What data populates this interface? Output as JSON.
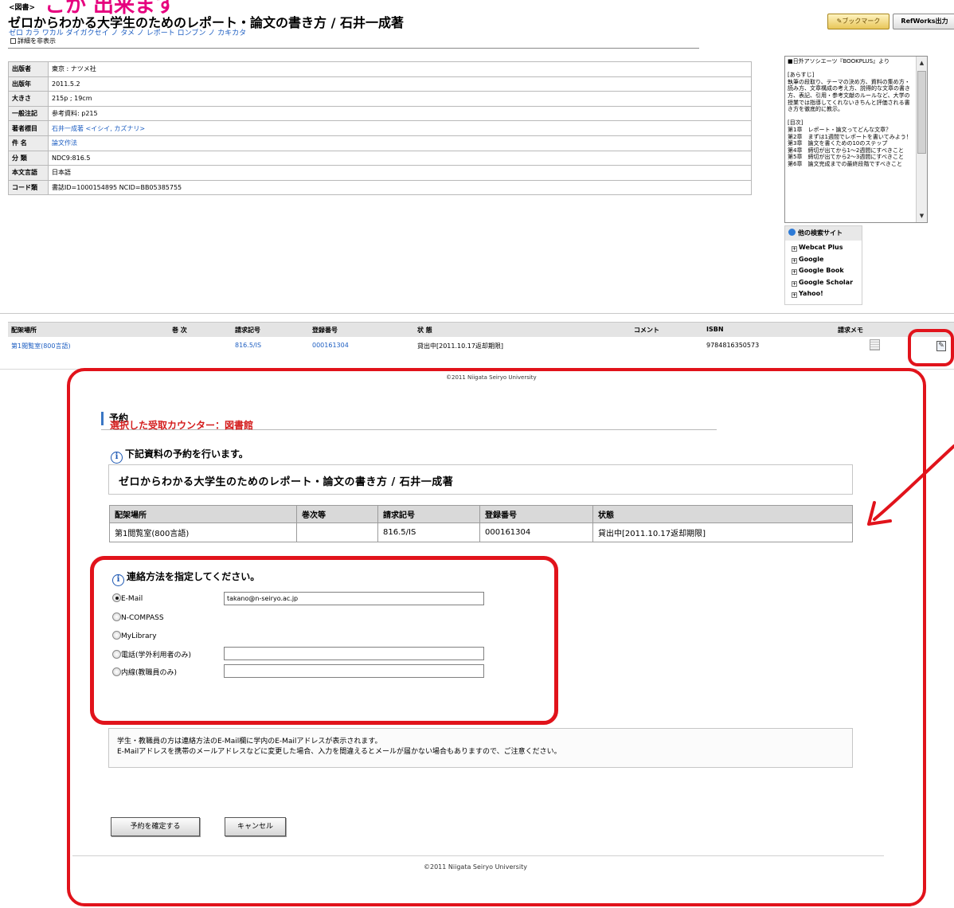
{
  "banner": {
    "text": "こか 出来ます"
  },
  "record": {
    "category": "<図書>",
    "title": "ゼロからわかる大学生のためのレポート・論文の書き方 / 石井一成著",
    "kana": "ゼロ カラ ワカル ダイガクセイ ノ タメ ノ レポート ロンブン ノ カキカタ",
    "detail_toggle": "詳細を非表示",
    "bookmark_label": "ブックマーク",
    "refworks_label": "RefWorks出力",
    "fields": [
      {
        "label": "出版者",
        "value": "東京 : ナツメ社",
        "link": false
      },
      {
        "label": "出版年",
        "value": "2011.5.2",
        "link": false
      },
      {
        "label": "大きさ",
        "value": "215p ; 19cm",
        "link": false
      },
      {
        "label": "一般注記",
        "value": "参考資料: p215",
        "link": false
      },
      {
        "label": "著者標目",
        "value": "石井一成著 <イシイ, カズナリ>",
        "link": true
      },
      {
        "label": "件 名",
        "value": "論文作法",
        "link": true
      },
      {
        "label": "分 類",
        "value": "NDC9:816.5",
        "link": false
      },
      {
        "label": "本文言語",
        "value": "日本語",
        "link": false
      },
      {
        "label": "コード類",
        "value": "書誌ID=1000154895 NCID=BB05385755",
        "link": false
      }
    ]
  },
  "synopsis": {
    "text": "■日外アソシエーツ『BOOKPLUS』より\n\n[あらすじ]\n執筆の段取り、テーマの決め方、資料の集め方・読み方、文章構成の考え方、説得的な文章の書き方、表記、引用・参考文献のルールなど、大学の授業では指導してくれないきちんと評価される書き方を徹底的に教示。\n\n[目次]\n第1章　レポート・論文ってどんな文章？\n第2章　まずは1週間でレポートを書いてみよう！\n第3章　論文を書くための10のステップ\n第4章　締切が出てから1～2週間にすべきこと\n第5章　締切が出てから2～3週間にすべきこと\n第6章　論文完成までの最終段階ですべきこと"
  },
  "search_sites": {
    "heading": "他の検索サイト",
    "items": [
      "Webcat Plus",
      "Google",
      "Google Book",
      "Google Scholar",
      "Yahoo!"
    ]
  },
  "holdings": {
    "headers": [
      "配架場所",
      "巻 次",
      "請求記号",
      "登録番号",
      "状 態",
      "コメント",
      "ISBN",
      "請求メモ"
    ],
    "row": {
      "location": "第1閲覧室(800言語)",
      "call_number": "816.5/IS",
      "reg_number": "000161304",
      "status": "貸出中[2011.10.17返却期限]",
      "isbn": "9784816350573"
    }
  },
  "reservation": {
    "copyright_top": "©2011 Niigata Seiryo University",
    "heading": "予約",
    "counter": "選択した受取カウンター：図書館",
    "notice": "下記資料の予約を行います。",
    "title": "ゼロからわかる大学生のためのレポート・論文の書き方 / 石井一成著",
    "table_headers": [
      "配架場所",
      "巻次等",
      "請求記号",
      "登録番号",
      "状態"
    ],
    "table_row": [
      "第1閲覧室(800言語)",
      "",
      "816.5/IS",
      "000161304",
      "貸出中[2011.10.17返却期限]"
    ],
    "contact_heading": "連絡方法を指定してください。",
    "contact_options": [
      {
        "label": "E-Mail",
        "checked": true,
        "value": "takano@n-seiryo.ac.jp"
      },
      {
        "label": "N-COMPASS",
        "checked": false
      },
      {
        "label": "MyLibrary",
        "checked": false
      },
      {
        "label": "電話(学外利用者のみ)",
        "checked": false,
        "value": ""
      },
      {
        "label": "内線(教職員のみ)",
        "checked": false,
        "value": ""
      }
    ],
    "guidance": "学生・教職員の方は連絡方法のE-Mail欄に学内のE-Mailアドレスが表示されます。\nE-Mailアドレスを携帯のメールアドレスなどに変更した場合、入力を間違えるとメールが届かない場合もありますので、ご注意ください。",
    "confirm_label": "予約を確定する",
    "cancel_label": "キャンセル",
    "copyright_bottom": "©2011 Niigata Seiryo University"
  },
  "colors": {
    "highlight": "#e1131b",
    "link": "#1d5ec2",
    "banner": "#e6007e",
    "counter": "#d41d1d"
  }
}
